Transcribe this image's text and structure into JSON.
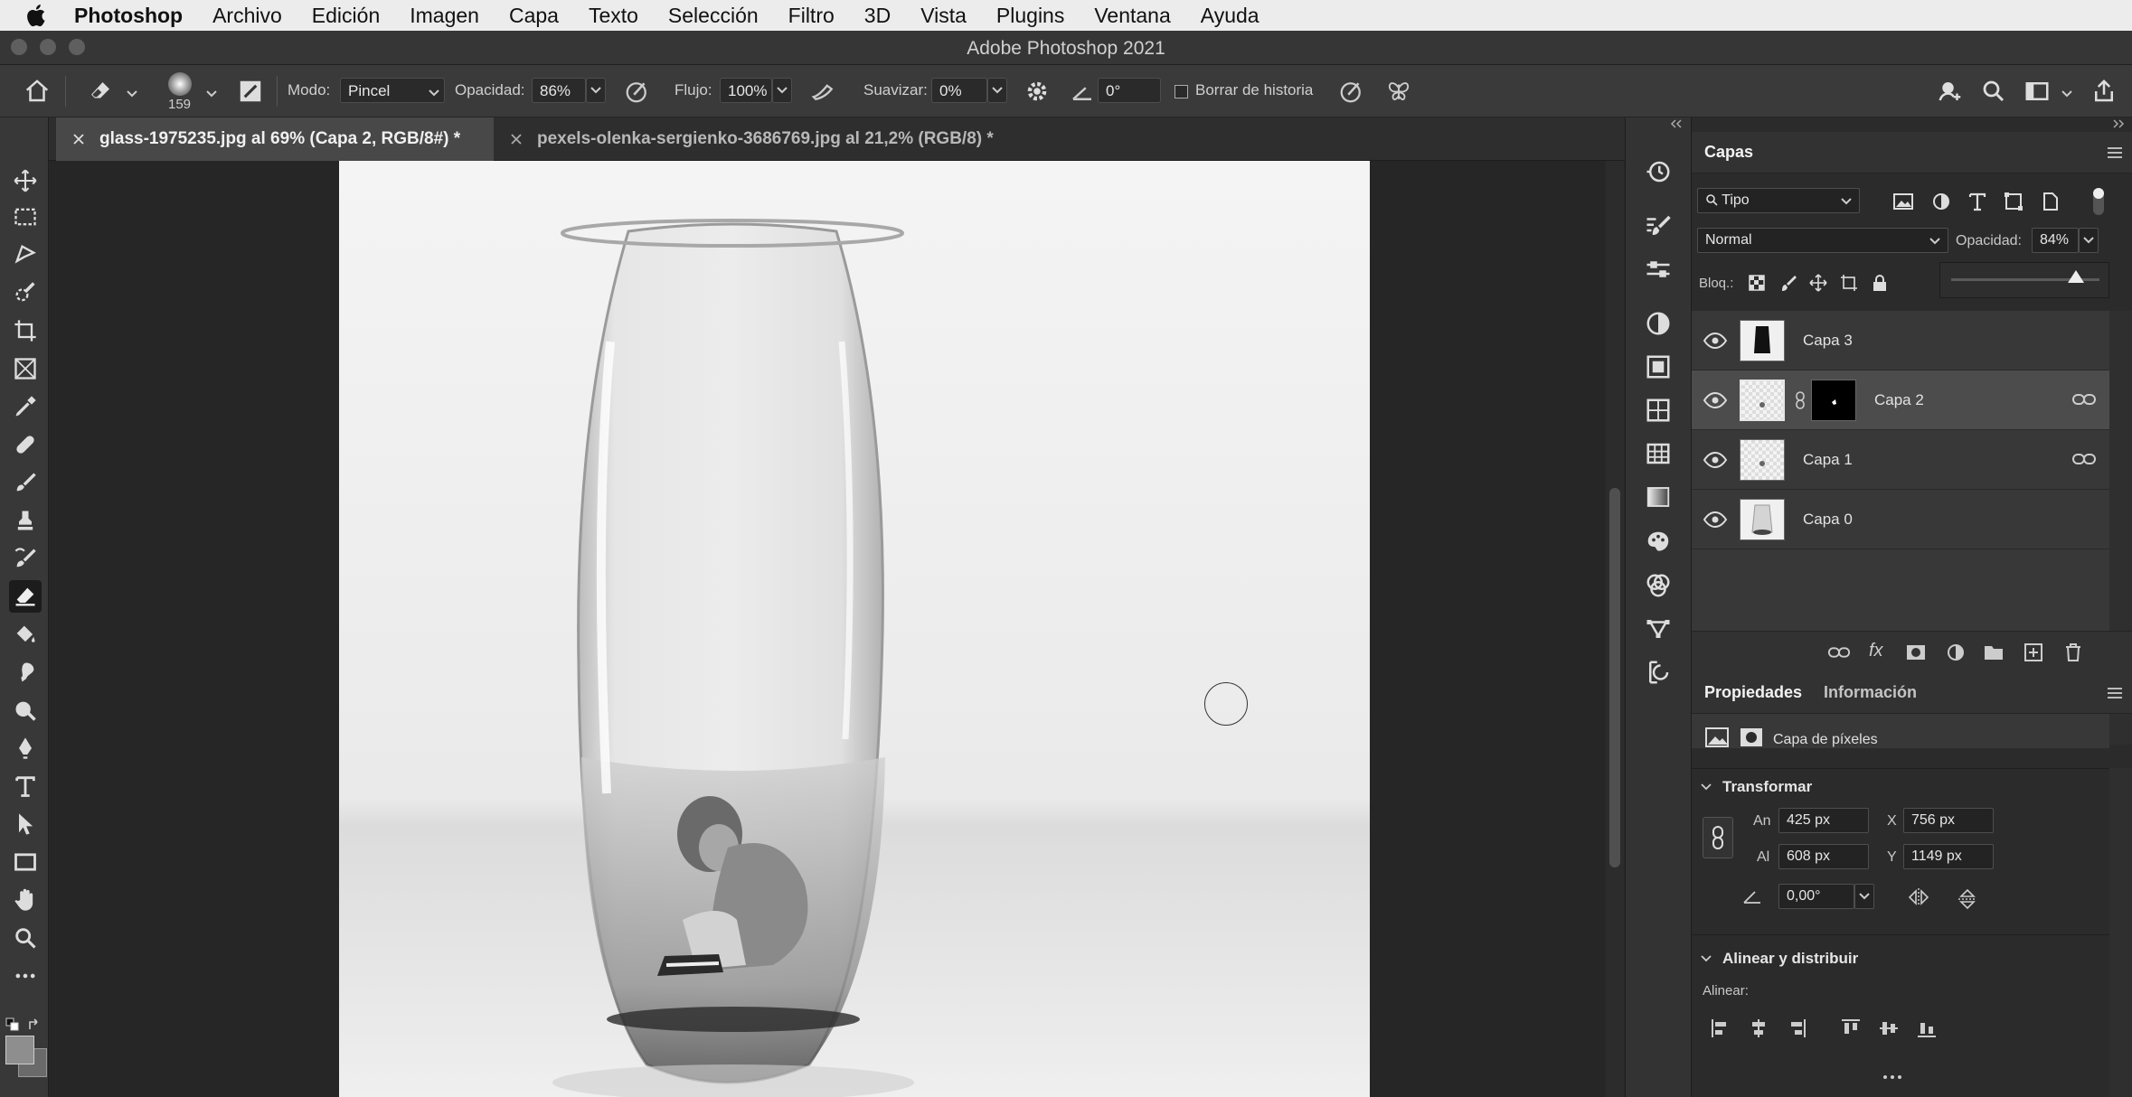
{
  "menubar": {
    "app_name": "Photoshop",
    "items": [
      "Archivo",
      "Edición",
      "Imagen",
      "Capa",
      "Texto",
      "Selección",
      "Filtro",
      "3D",
      "Vista",
      "Plugins",
      "Ventana",
      "Ayuda"
    ]
  },
  "window": {
    "title": "Adobe Photoshop 2021"
  },
  "options_bar": {
    "brush_size": "159",
    "mode_label": "Modo:",
    "mode_value": "Pincel",
    "opacity_label": "Opacidad:",
    "opacity_value": "86%",
    "flow_label": "Flujo:",
    "flow_value": "100%",
    "smoothing_label": "Suavizar:",
    "smoothing_value": "0%",
    "angle_value": "0°",
    "erase_history_label": "Borrar de historia"
  },
  "tabs": [
    {
      "label": "glass-1975235.jpg al 69% (Capa 2, RGB/8#) *",
      "active": true
    },
    {
      "label": "pexels-olenka-sergienko-3686769.jpg al 21,2% (RGB/8) *",
      "active": false
    }
  ],
  "layers_panel": {
    "title": "Capas",
    "filter_kind": "Tipo",
    "blend_mode": "Normal",
    "opacity_label": "Opacidad:",
    "opacity_value": "84%",
    "opacity_fraction": 0.84,
    "lock_label": "Bloq.:",
    "layers": [
      {
        "name": "Capa 3",
        "selected": false,
        "has_mask": false,
        "linked": false
      },
      {
        "name": "Capa 2",
        "selected": true,
        "has_mask": true,
        "linked": true
      },
      {
        "name": "Capa 1",
        "selected": false,
        "has_mask": false,
        "linked": true
      },
      {
        "name": "Capa 0",
        "selected": false,
        "has_mask": false,
        "linked": false
      }
    ]
  },
  "properties_panel": {
    "tab_active": "Propiedades",
    "tab_inactive": "Información",
    "layer_type": "Capa de píxeles",
    "transform_title": "Transformar",
    "width_label": "An",
    "width_value": "425 px",
    "height_label": "Al",
    "height_value": "608 px",
    "x_label": "X",
    "x_value": "756 px",
    "y_label": "Y",
    "y_value": "1149 px",
    "angle_value": "0,00°",
    "align_title": "Alinear y distribuir",
    "align_label": "Alinear:"
  },
  "colors": {
    "panel_bg": "#2b2b2b",
    "selected_layer": "#4c4c4c",
    "menubar_bg": "#ececec"
  }
}
